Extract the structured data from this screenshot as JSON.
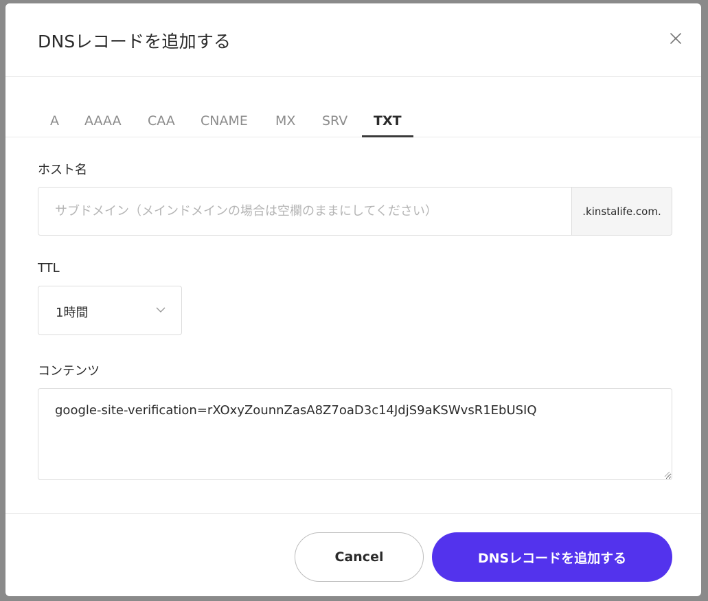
{
  "dialog": {
    "title": "DNSレコードを追加する"
  },
  "tabs": [
    {
      "label": "A"
    },
    {
      "label": "AAAA"
    },
    {
      "label": "CAA"
    },
    {
      "label": "CNAME"
    },
    {
      "label": "MX"
    },
    {
      "label": "SRV"
    },
    {
      "label": "TXT",
      "active": true
    }
  ],
  "host": {
    "label": "ホスト名",
    "placeholder": "サブドメイン（メインドメインの場合は空欄のままにしてください）",
    "value": "",
    "suffix": ".kinstalife.com."
  },
  "ttl": {
    "label": "TTL",
    "selected": "1時間"
  },
  "content": {
    "label": "コンテンツ",
    "value": "google-site-verification=rXOxyZounnZasA8Z7oaD3c14JdjS9aKSWvsR1EbUSIQ"
  },
  "footer": {
    "cancel_label": "Cancel",
    "submit_label": "DNSレコードを追加する"
  },
  "colors": {
    "primary": "#5333ed",
    "active_tab_underline": "#3a3a3a",
    "text": "#2a2a2a",
    "muted_tab": "#8b8b8b"
  },
  "icons": {
    "close": "close-icon",
    "chevron": "chevron-down-icon",
    "resize": "resize-grip-icon"
  }
}
